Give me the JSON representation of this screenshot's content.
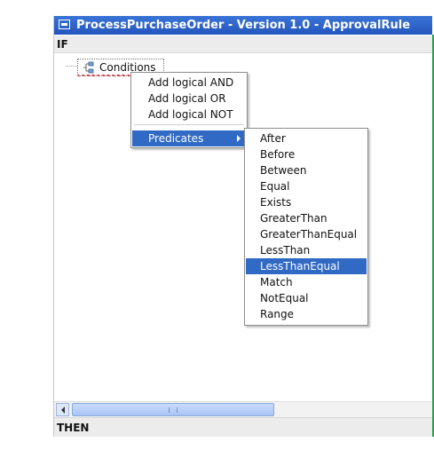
{
  "window": {
    "title": "ProcessPurchaseOrder - Version 1.0 - ApprovalRule"
  },
  "sections": {
    "if_label": "IF",
    "then_label": "THEN"
  },
  "tree": {
    "node_label": "Conditions",
    "node_icon": "condition-tree-icon"
  },
  "context_menu": {
    "items": [
      "Add logical AND",
      "Add logical OR",
      "Add logical NOT"
    ],
    "predicates_label": "Predicates"
  },
  "predicates_menu": {
    "items": [
      "After",
      "Before",
      "Between",
      "Equal",
      "Exists",
      "GreaterThan",
      "GreaterThanEqual",
      "LessThan",
      "LessThanEqual",
      "Match",
      "NotEqual",
      "Range"
    ],
    "highlighted": "LessThanEqual"
  },
  "scrollbar": {
    "grip": "III"
  },
  "colors": {
    "titlebar": "#2456bd",
    "highlight": "#316ac5",
    "accent_strip": "#2e9a54"
  }
}
